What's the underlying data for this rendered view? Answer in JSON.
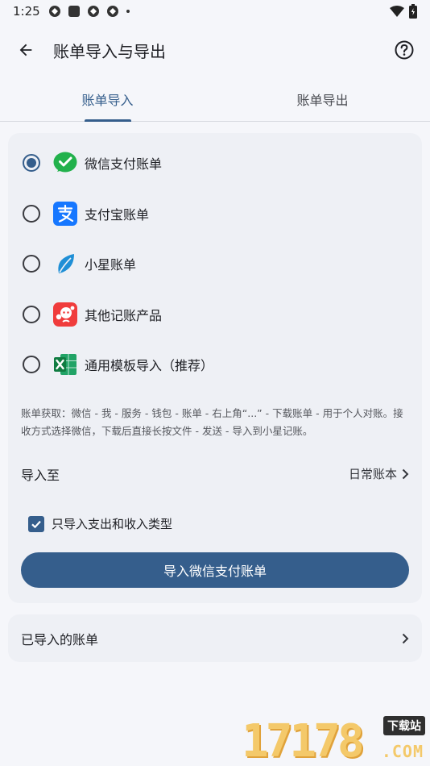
{
  "status_bar": {
    "time": "1:25"
  },
  "app_bar": {
    "title": "账单导入与导出"
  },
  "tabs": [
    {
      "label": "账单导入",
      "active": true
    },
    {
      "label": "账单导出",
      "active": false
    }
  ],
  "sources": [
    {
      "label": "微信支付账单",
      "selected": true,
      "icon": "wechat-pay-icon"
    },
    {
      "label": "支付宝账单",
      "selected": false,
      "icon": "alipay-icon"
    },
    {
      "label": "小星账单",
      "selected": false,
      "icon": "leaf-icon"
    },
    {
      "label": "其他记账产品",
      "selected": false,
      "icon": "other-app-icon"
    },
    {
      "label": "通用模板导入（推荐）",
      "selected": false,
      "icon": "excel-icon"
    }
  ],
  "hint": "账单获取：微信 - 我 - 服务 - 钱包 - 账单 - 右上角“...” - 下载账单 - 用于个人对账。接收方式选择微信，下载后直接长按文件 - 发送 - 导入到小星记账。",
  "destination": {
    "label": "导入至",
    "value": "日常账本"
  },
  "only_types": {
    "label": "只导入支出和收入类型",
    "checked": true
  },
  "import_button": "导入微信支付账单",
  "imported_bills": "已导入的账单",
  "watermark": {
    "digits": "17178",
    "tag": "下载站",
    "domain": ".COM"
  },
  "colors": {
    "accent": "#355e8c",
    "background": "#f5f6fa",
    "card": "#eef0f5"
  }
}
